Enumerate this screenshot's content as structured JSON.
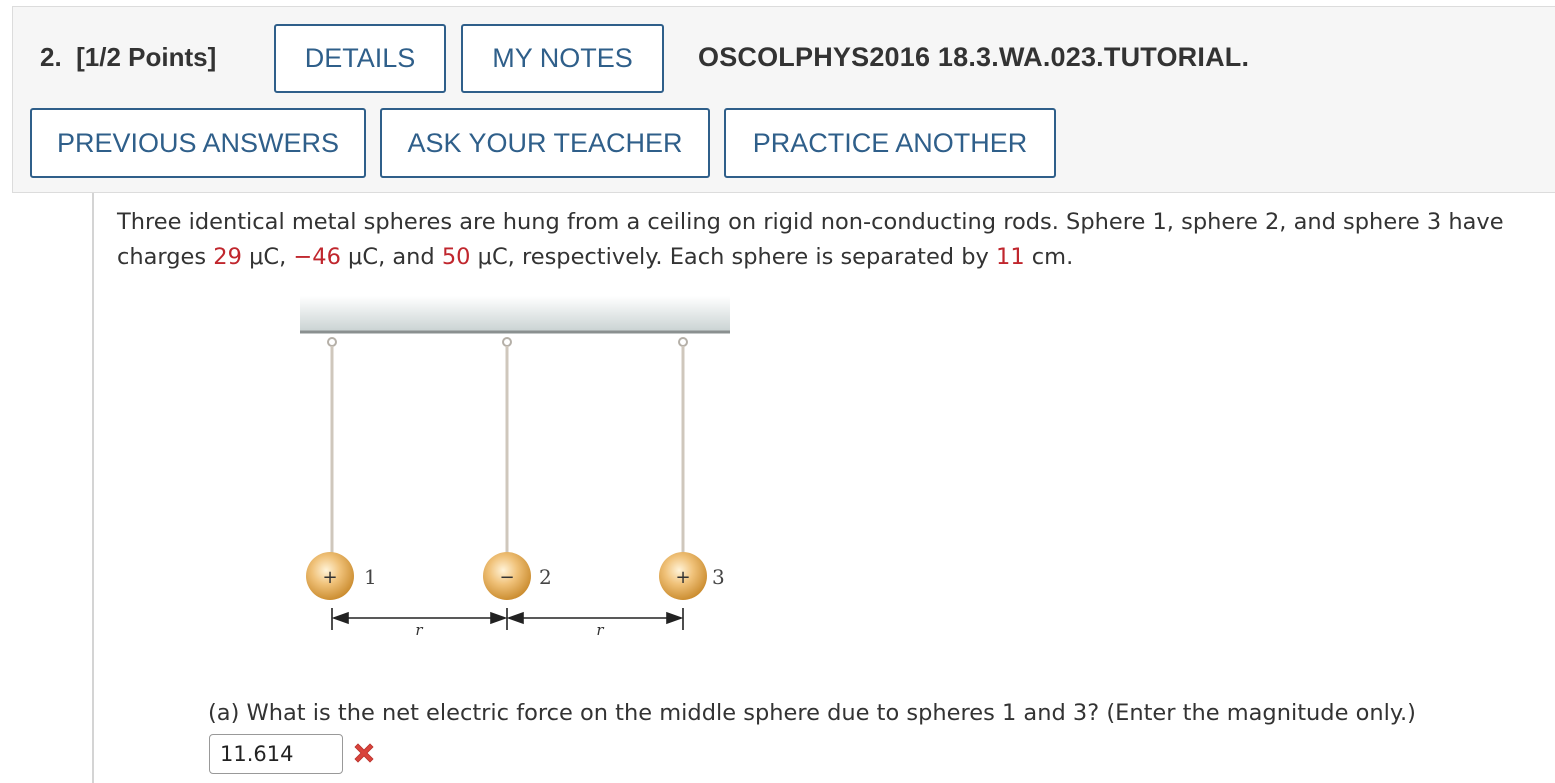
{
  "header": {
    "question_number": "2.",
    "points": "[1/2 Points]",
    "buttons": {
      "details": "DETAILS",
      "my_notes": "MY NOTES",
      "previous_answers": "PREVIOUS ANSWERS",
      "ask_teacher": "ASK YOUR TEACHER",
      "practice_another": "PRACTICE ANOTHER"
    },
    "reference": "OSCOLPHYS2016 18.3.WA.023.TUTORIAL."
  },
  "problem": {
    "line1": "Three identical metal spheres are hung from a ceiling on rigid non-conducting rods. Sphere 1, sphere 2, and sphere 3 have",
    "line2_a": "charges ",
    "q1": "29",
    "unit1": " μC, ",
    "q2": "−46",
    "unit2": " μC, and ",
    "q3": "50",
    "unit3": " μC, respectively. Each sphere is separated by ",
    "distance": "11",
    "unit4": " cm."
  },
  "figure": {
    "sphere_labels": [
      "1",
      "2",
      "3"
    ],
    "sphere_signs": [
      "+",
      "−",
      "+"
    ],
    "distance_label": "r"
  },
  "part_a": {
    "question": "(a) What is the net electric force on the middle sphere due to spheres 1 and 3? (Enter the magnitude only.)",
    "answer_value": "11.614",
    "status_icon": "incorrect-x-icon"
  },
  "colors": {
    "accent": "#2f5f8a",
    "highlight": "#c0262d",
    "incorrect": "#d9433c"
  }
}
